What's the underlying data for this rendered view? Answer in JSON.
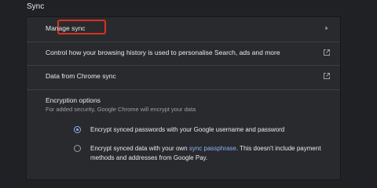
{
  "section": {
    "title": "Sync"
  },
  "rows": {
    "manage_sync": "Manage sync",
    "control_history": "Control how your browsing history is used to personalise Search, ads and more",
    "data_from_sync": "Data from Chrome sync"
  },
  "encryption": {
    "title": "Encryption options",
    "subtitle": "For added security, Google Chrome will encrypt your data",
    "option1": "Encrypt synced passwords with your Google username and password",
    "option2_before": "Encrypt synced data with your own ",
    "option2_link": "sync passphrase",
    "option2_after": ". This doesn't include payment methods and addresses from Google Pay.",
    "selected": 1
  },
  "icons": {
    "chevron": "chevron-right-icon",
    "external": "external-link-icon"
  },
  "colors": {
    "background": "#202124",
    "card": "#292a2d",
    "accent": "#8ab4f8",
    "highlight": "#d93025"
  }
}
